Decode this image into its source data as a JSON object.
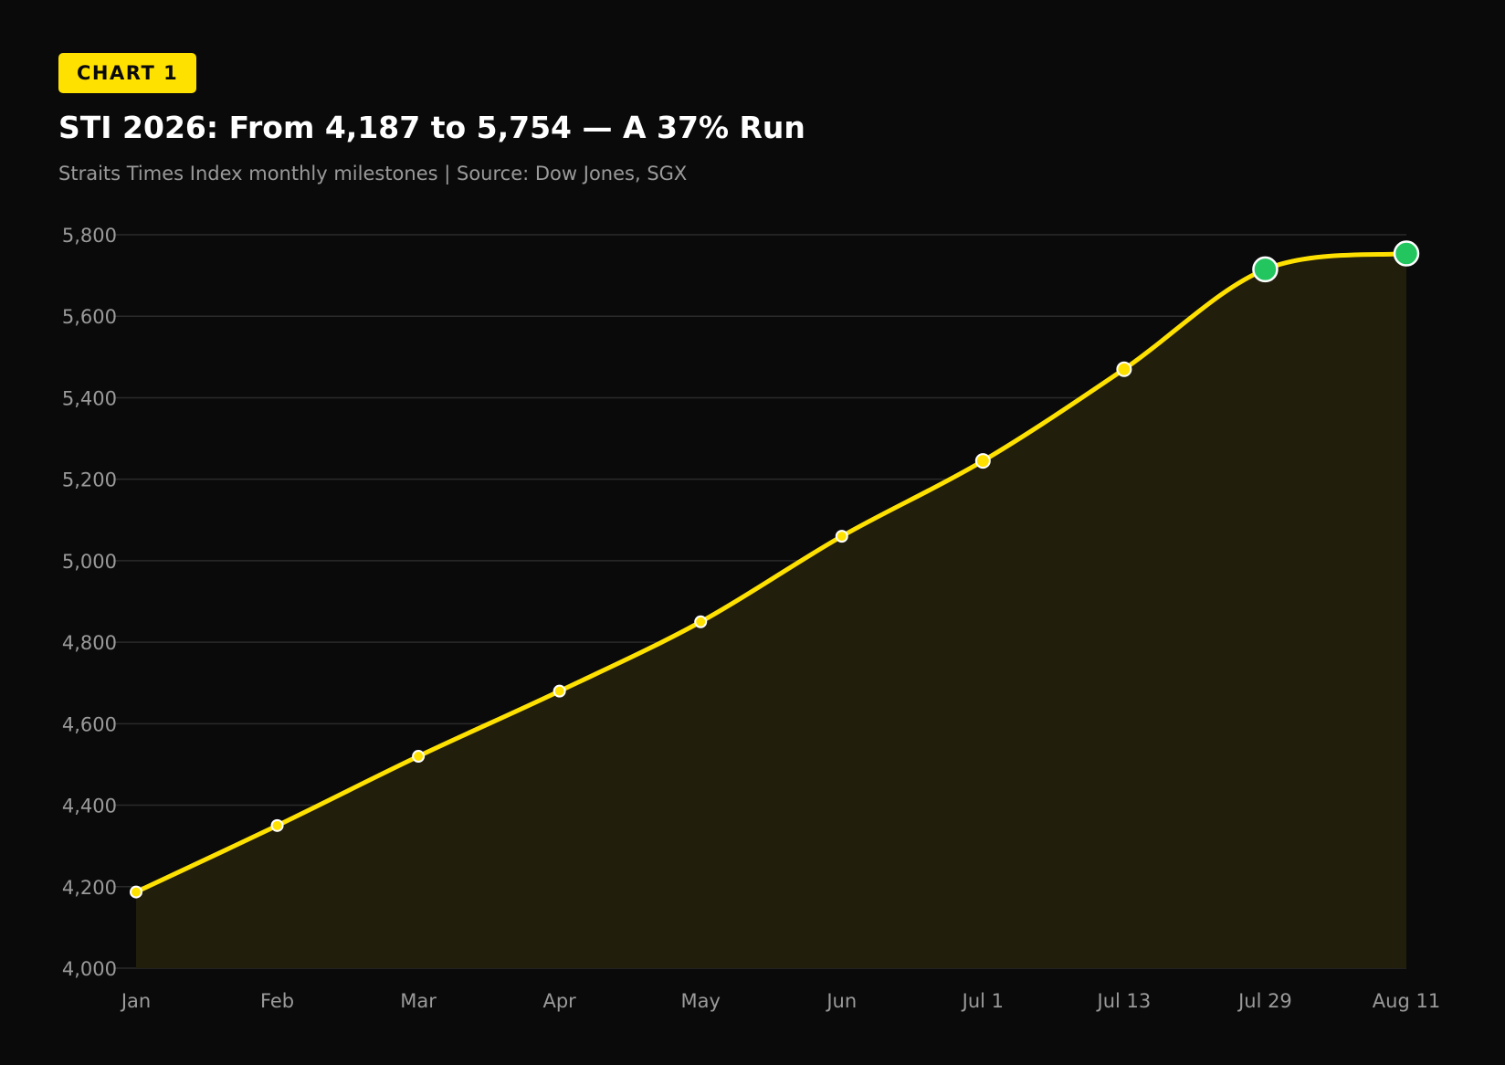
{
  "header": {
    "badge": "CHART 1",
    "title": "STI 2026: From 4,187 to 5,754 — A 37% Run",
    "subtitle": "Straits Times Index monthly milestones | Source: Dow Jones, SGX"
  },
  "colors": {
    "background": "#0a0a0a",
    "line": "#ffe100",
    "area_fill": "#211e0b",
    "highlight_point": "#22c55e",
    "grid": "#2a2a2a",
    "text_muted": "#9a9a9a"
  },
  "chart_data": {
    "type": "area",
    "categories": [
      "Jan",
      "Feb",
      "Mar",
      "Apr",
      "May",
      "Jun",
      "Jul 1",
      "Jul 13",
      "Jul 29",
      "Aug 11"
    ],
    "series": [
      {
        "values": [
          4187,
          4350,
          4520,
          4680,
          4850,
          5060,
          5245,
          5470,
          5715,
          5754
        ]
      }
    ],
    "highlighted_categories": [
      "Jul 29",
      "Aug 11"
    ],
    "ylim": [
      4000,
      5800
    ],
    "yticks": [
      4000,
      4200,
      4400,
      4600,
      4800,
      5000,
      5200,
      5400,
      5600,
      5800
    ],
    "ytick_labels": [
      "4,000",
      "4,200",
      "4,400",
      "4,600",
      "4,800",
      "5,000",
      "5,200",
      "5,400",
      "5,600",
      "5,800"
    ],
    "grid": true,
    "legend": "none"
  }
}
